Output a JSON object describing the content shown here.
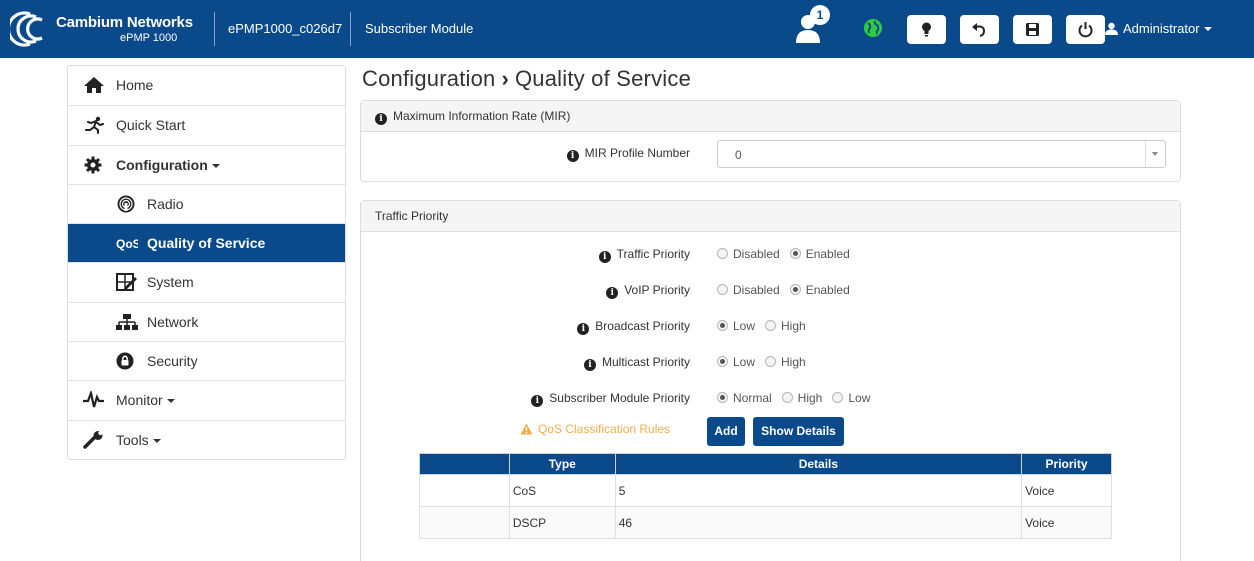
{
  "header": {
    "brand_name": "Cambium Networks",
    "brand_model": "ePMP 1000",
    "device_name": "ePMP1000_c026d7",
    "device_mode": "Subscriber Module",
    "notification_count": "1",
    "user": "Administrator",
    "buttons": [
      "lightbulb-icon",
      "undo-icon",
      "save-icon",
      "power-icon"
    ],
    "colors": {
      "navbar": "#0a4a8b",
      "status_globe": "#2ecc40"
    }
  },
  "sidebar": {
    "items": [
      {
        "label": "Home",
        "icon": "home-icon"
      },
      {
        "label": "Quick Start",
        "icon": "runner-icon"
      },
      {
        "label": "Configuration",
        "icon": "gear-icon"
      },
      {
        "label": "Radio",
        "icon": "radio-icon"
      },
      {
        "label": "Quality of Service",
        "icon": "qos-icon"
      },
      {
        "label": "System",
        "icon": "system-icon"
      },
      {
        "label": "Network",
        "icon": "network-icon"
      },
      {
        "label": "Security",
        "icon": "lock-icon"
      },
      {
        "label": "Monitor",
        "icon": "pulse-icon"
      },
      {
        "label": "Tools",
        "icon": "wrench-icon"
      }
    ]
  },
  "page": {
    "title_section": "Configuration",
    "title_page": "Quality of Service"
  },
  "mir": {
    "heading": "Maximum Information Rate (MIR)",
    "profile_label": "MIR Profile Number",
    "profile_value": "0"
  },
  "traffic": {
    "heading": "Traffic Priority",
    "fields": [
      {
        "label": "Traffic Priority",
        "options": [
          "Disabled",
          "Enabled"
        ],
        "selected": "Enabled"
      },
      {
        "label": "VoIP Priority",
        "options": [
          "Disabled",
          "Enabled"
        ],
        "selected": "Enabled"
      },
      {
        "label": "Broadcast Priority",
        "options": [
          "Low",
          "High"
        ],
        "selected": "Low"
      },
      {
        "label": "Multicast Priority",
        "options": [
          "Low",
          "High"
        ],
        "selected": "Low"
      },
      {
        "label": "Subscriber Module Priority",
        "options": [
          "Normal",
          "High",
          "Low"
        ],
        "selected": "Normal"
      }
    ],
    "rules_label": "QoS Classification Rules",
    "add_label": "Add",
    "details_label": "Show Details"
  },
  "rules_table": {
    "headers": [
      "",
      "Type",
      "Details",
      "Priority"
    ],
    "rows": [
      {
        "type": "CoS",
        "details": "5",
        "priority": "Voice"
      },
      {
        "type": "DSCP",
        "details": "46",
        "priority": "Voice"
      }
    ]
  }
}
